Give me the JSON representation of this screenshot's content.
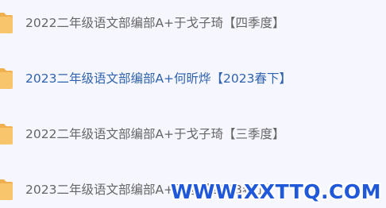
{
  "items": [
    {
      "label": "2022二年级语文部编部A+于戈子琦【四季度】",
      "icon": "folder-icon",
      "active": false
    },
    {
      "label": "2023二年级语文部编部A+何昕烨【2023春下】",
      "icon": "folder-icon",
      "active": true
    },
    {
      "label": "2022二年级语文部编部A+于戈子琦【三季度】",
      "icon": "folder-icon",
      "active": false
    },
    {
      "label": "2023二年级语文部编部A+王越【2023春上】",
      "icon": "folder-icon",
      "active": false
    }
  ],
  "colors": {
    "background": "#f5f6fe",
    "text": "#666666",
    "active_text": "#2f63ae",
    "folder": "#f9c56c",
    "watermark": "#1f58d8"
  },
  "watermark": "WWW.XXTTQ.COM"
}
